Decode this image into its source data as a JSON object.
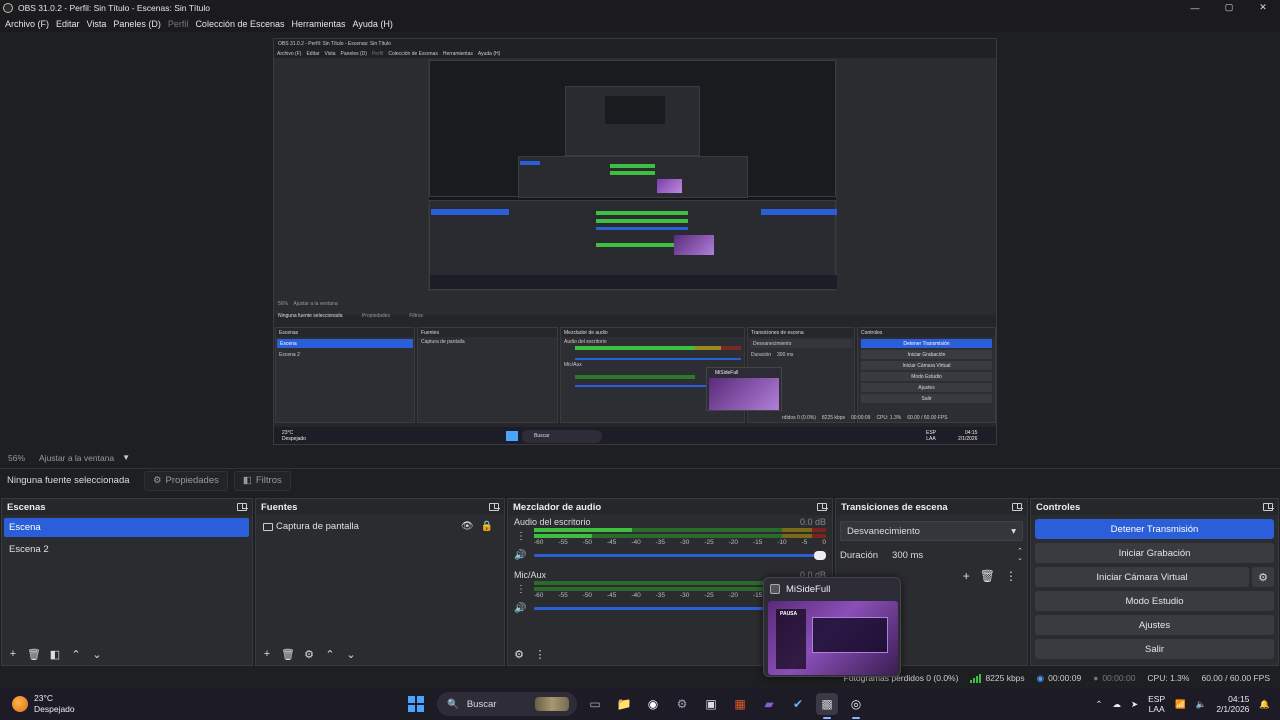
{
  "window": {
    "title": "OBS 31.0.2 - Perfil: Sin Título - Escenas: Sin Título",
    "controls": [
      "—",
      "▢",
      "✕"
    ]
  },
  "menu": {
    "items": [
      "Archivo (F)",
      "Editar",
      "Vista",
      "Paneles (D)",
      "Perfil",
      "Colección de Escenas",
      "Herramientas",
      "Ayuda (H)"
    ]
  },
  "nested": {
    "title": "OBS 31.0.2 - Perfil: Sin Título - Escenas: Sin Título",
    "menu": [
      "Archivo (F)",
      "Editar",
      "Vista",
      "Paneles (D)",
      "Perfil",
      "Colección de Escenas",
      "Herramientas",
      "Ayuda (H)"
    ],
    "zoom": "56%",
    "fit": "Ajustar a la ventana",
    "no_source": "Ninguna fuente seleccionada",
    "props": "Propiedades",
    "filters": "Filtros",
    "scenes_header": "Escenas",
    "scenes": [
      "Escena",
      "Escena 2"
    ],
    "sources_header": "Fuentes",
    "source": "Captura de pantalla",
    "mixer_header": "Mezclador de audio",
    "desktop_audio": "Audio del escritorio",
    "mic": "Mic/Aux",
    "transitions_header": "Transiciones de escena",
    "transition": "Desvanecimiento",
    "duration": "Duración",
    "duration_val": "300 ms",
    "controls_header": "Controles",
    "controls": [
      "Detener Transmisión",
      "Iniciar Grabación",
      "Iniciar Cámara Virtual",
      "Modo Estudio",
      "Ajustes",
      "Salir"
    ],
    "popup_title": "MiSideFull",
    "status_frames": "rdidos 0 (0.0%)",
    "status_kbps": "8225 kbps",
    "status_time": "00:00:09",
    "status_cpu": "CPU: 1.3%",
    "status_fps": "60.00 / 60.00 FPS",
    "weather_temp": "23°C",
    "weather_desc": "Despejado",
    "search": "Buscar",
    "lang1": "ESP",
    "lang2": "LAA",
    "time": "04:15",
    "date": "2/1/2026"
  },
  "preview": {
    "zoom": "56%",
    "fit_label": "Ajustar a la ventana"
  },
  "sourcebar": {
    "no_source": "Ninguna fuente seleccionada",
    "properties": "Propiedades",
    "filters": "Filtros"
  },
  "scenes": {
    "header": "Escenas",
    "items": [
      "Escena",
      "Escena 2"
    ]
  },
  "sources": {
    "header": "Fuentes",
    "items": [
      "Captura de pantalla"
    ]
  },
  "mixer": {
    "header": "Mezclador de audio",
    "channels": [
      {
        "name": "Audio del escritorio",
        "db": "0.0 dB"
      },
      {
        "name": "Mic/Aux",
        "db": "0.0 dB"
      }
    ],
    "ticks": [
      "-60",
      "-55",
      "-50",
      "-45",
      "-40",
      "-35",
      "-30",
      "-25",
      "-20",
      "-15",
      "-10",
      "-5",
      "0"
    ]
  },
  "transitions": {
    "header": "Transiciones de escena",
    "selected": "Desvanecimiento",
    "duration_label": "Duración",
    "duration_value": "300 ms"
  },
  "controls": {
    "header": "Controles",
    "stop_stream": "Detener Transmisión",
    "start_record": "Iniciar Grabación",
    "virtual_cam": "Iniciar Cámara Virtual",
    "studio_mode": "Modo Estudio",
    "settings": "Ajustes",
    "exit": "Salir"
  },
  "popup": {
    "title": "MiSideFull",
    "thumb_text": "PAUSA"
  },
  "status": {
    "frames_dropped": "Fotogramas perdidos 0 (0.0%)",
    "bitrate": "8225 kbps",
    "stream_time": "00:00:09",
    "record_time": "00:00:00",
    "cpu": "CPU: 1.3%",
    "fps": "60.00 / 60.00 FPS"
  },
  "taskbar": {
    "weather_temp": "23°C",
    "weather_desc": "Despejado",
    "search_placeholder": "Buscar",
    "lang_top": "ESP",
    "lang_bottom": "LAA",
    "time": "04:15",
    "date": "2/1/2026"
  },
  "colors": {
    "accent": "#2b5fd9",
    "meter_green": "#3fbf3f",
    "meter_yellow": "#c9b82a",
    "meter_red": "#b8302a"
  }
}
